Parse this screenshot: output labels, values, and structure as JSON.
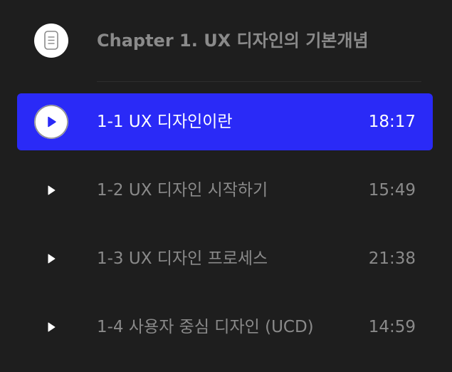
{
  "chapter": {
    "title": "Chapter 1. UX 디자인의 기본개념",
    "icon": "document-icon"
  },
  "colors": {
    "background": "#1e1e1e",
    "accent": "#2a2af7",
    "muted_text": "#8a8a8a",
    "active_text": "#ffffff"
  },
  "lessons": [
    {
      "title": "1-1 UX 디자인이란",
      "duration": "18:17",
      "active": true,
      "icon": "play-circle-icon"
    },
    {
      "title": "1-2 UX 디자인 시작하기",
      "duration": "15:49",
      "active": false,
      "icon": "play-icon"
    },
    {
      "title": "1-3 UX 디자인 프로세스",
      "duration": "21:38",
      "active": false,
      "icon": "play-icon"
    },
    {
      "title": "1-4 사용자 중심 디자인 (UCD)",
      "duration": "14:59",
      "active": false,
      "icon": "play-icon"
    }
  ]
}
